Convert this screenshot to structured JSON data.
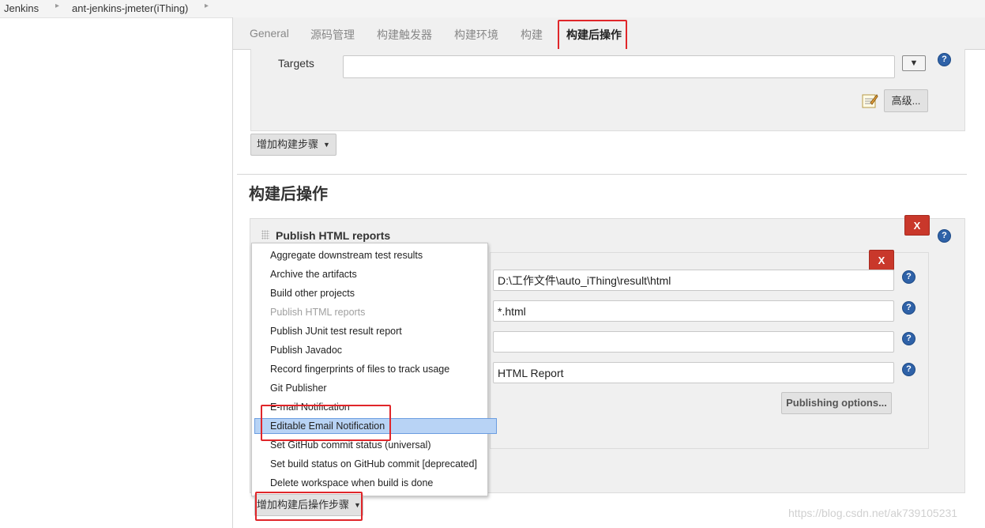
{
  "breadcrumb": {
    "items": [
      "Jenkins",
      "ant-jenkins-jmeter(iThing)"
    ],
    "separator": "▸"
  },
  "tabs": [
    "General",
    "源码管理",
    "构建触发器",
    "构建环境",
    "构建",
    "构建后操作"
  ],
  "active_tab": "构建后操作",
  "build_section": {
    "targets_label": "Targets",
    "targets_value": "",
    "advanced_button": "高级...",
    "add_build_step_button": "增加构建步骤"
  },
  "post_build": {
    "title": "构建后操作",
    "publish_html": {
      "title": "Publish HTML reports",
      "fields": [
        {
          "value": "D:\\工作文件\\auto_iThing\\result\\html"
        },
        {
          "value": "*.html"
        },
        {
          "value": ""
        },
        {
          "value": "HTML Report"
        }
      ],
      "publishing_options_button": "Publishing options..."
    },
    "delete_label": "X",
    "add_post_build_step_button": "增加构建后操作步骤"
  },
  "dropdown": {
    "items": [
      {
        "label": "Aggregate downstream test results",
        "state": "normal"
      },
      {
        "label": "Archive the artifacts",
        "state": "normal"
      },
      {
        "label": "Build other projects",
        "state": "normal"
      },
      {
        "label": "Publish HTML reports",
        "state": "disabled"
      },
      {
        "label": "Publish JUnit test result report",
        "state": "normal"
      },
      {
        "label": "Publish Javadoc",
        "state": "normal"
      },
      {
        "label": "Record fingerprints of files to track usage",
        "state": "normal"
      },
      {
        "label": "Git Publisher",
        "state": "normal"
      },
      {
        "label": "E-mail Notification",
        "state": "normal"
      },
      {
        "label": "Editable Email Notification",
        "state": "highlighted"
      },
      {
        "label": "Set GitHub commit status (universal)",
        "state": "normal"
      },
      {
        "label": "Set build status on GitHub commit [deprecated]",
        "state": "normal"
      },
      {
        "label": "Delete workspace when build is done",
        "state": "normal"
      }
    ]
  },
  "help_icon_glyph": "?",
  "watermark": "https://blog.csdn.net/ak739105231",
  "colors": {
    "highlight_outline": "#e0262a",
    "delete_button": "#c9382b",
    "help_icon": "#2f62a8",
    "menu_highlight": "#b8d3f5"
  }
}
